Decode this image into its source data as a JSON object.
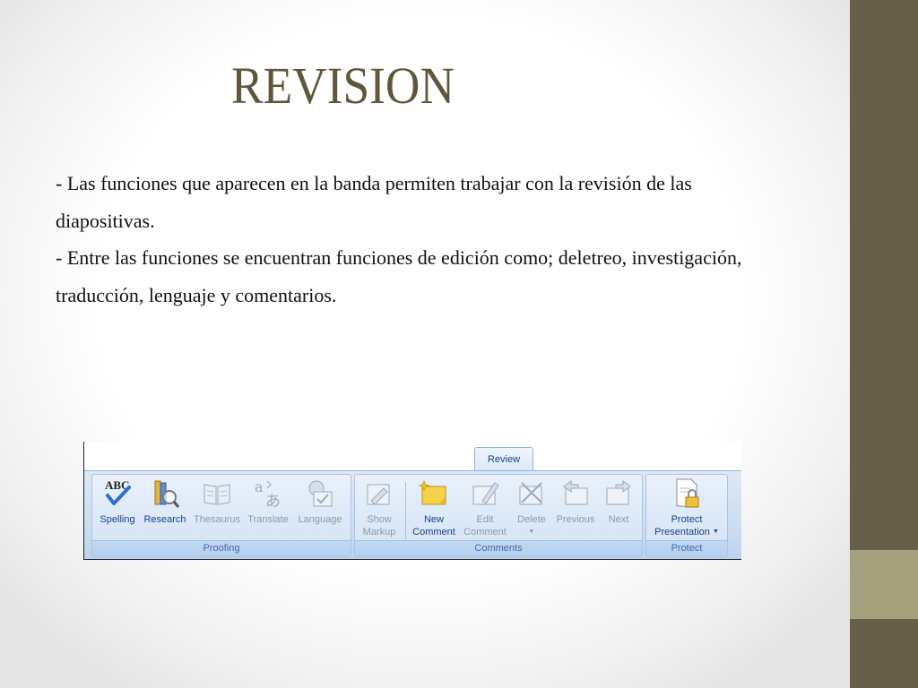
{
  "slide": {
    "title": "REVISION",
    "paragraphs": [
      "- Las funciones que aparecen en la banda permiten trabajar con la revisión de las diapositivas.",
      "- Entre las funciones se encuentran funciones de edición como; deletreo, investigación, traducción, lenguaje y comentarios."
    ]
  },
  "ribbon": {
    "active_tab": "Review",
    "groups": {
      "proofing": {
        "label": "Proofing",
        "buttons": [
          {
            "line1": "Spelling",
            "line2": "",
            "enabled": true,
            "icon": "spelling-abc-check-icon"
          },
          {
            "line1": "Research",
            "line2": "",
            "enabled": true,
            "icon": "research-books-icon"
          },
          {
            "line1": "Thesaurus",
            "line2": "",
            "enabled": false,
            "icon": "thesaurus-book-icon"
          },
          {
            "line1": "Translate",
            "line2": "",
            "enabled": false,
            "icon": "translate-icon"
          },
          {
            "line1": "Language",
            "line2": "",
            "enabled": false,
            "icon": "language-globe-icon"
          }
        ]
      },
      "comments": {
        "label": "Comments",
        "buttons": [
          {
            "line1": "Show",
            "line2": "Markup",
            "enabled": false,
            "icon": "show-markup-icon"
          },
          {
            "line1": "New",
            "line2": "Comment",
            "enabled": true,
            "icon": "new-comment-icon"
          },
          {
            "line1": "Edit",
            "line2": "Comment",
            "enabled": false,
            "icon": "edit-comment-icon"
          },
          {
            "line1": "Delete",
            "line2": "",
            "enabled": false,
            "icon": "delete-comment-icon"
          },
          {
            "line1": "Previous",
            "line2": "",
            "enabled": false,
            "icon": "previous-comment-icon"
          },
          {
            "line1": "Next",
            "line2": "",
            "enabled": false,
            "icon": "next-comment-icon"
          }
        ]
      },
      "protect": {
        "label": "Protect",
        "buttons": [
          {
            "line1": "Protect",
            "line2": "Presentation",
            "enabled": true,
            "icon": "protect-presentation-lock-icon"
          }
        ]
      }
    }
  },
  "colors": {
    "title": "#5f563c",
    "sidebar": "#685f48",
    "sidebar_accent": "#a6a17d",
    "ribbon_enabled_text": "#15428b",
    "ribbon_disabled_text": "#8d99a8"
  }
}
